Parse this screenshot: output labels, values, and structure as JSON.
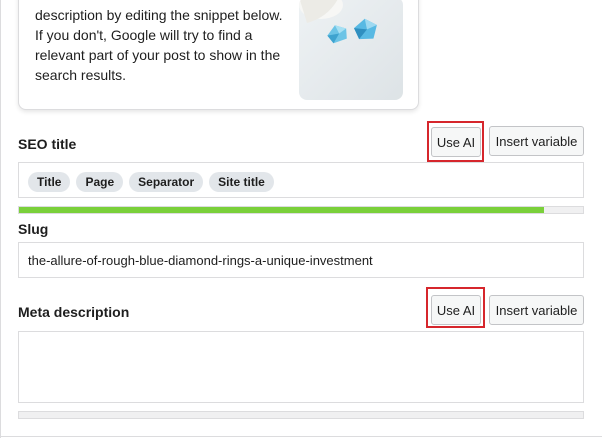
{
  "snippet": {
    "description": "description by editing the snippet below. If you don't, Google will try to find a relevant part of your post to show in the search results."
  },
  "seo_title": {
    "label": "SEO title",
    "use_ai_label": "Use AI",
    "insert_variable_label": "Insert variable",
    "variables": [
      "Title",
      "Page",
      "Separator",
      "Site title"
    ],
    "progress": 0.93,
    "progress_color": "#7ad03a"
  },
  "slug": {
    "label": "Slug",
    "value": "the-allure-of-rough-blue-diamond-rings-a-unique-investment"
  },
  "meta_description": {
    "label": "Meta description",
    "use_ai_label": "Use AI",
    "insert_variable_label": "Insert variable",
    "value": "",
    "progress": 0
  },
  "colors": {
    "highlight": "#d6262c",
    "progress_good": "#7ad03a"
  }
}
